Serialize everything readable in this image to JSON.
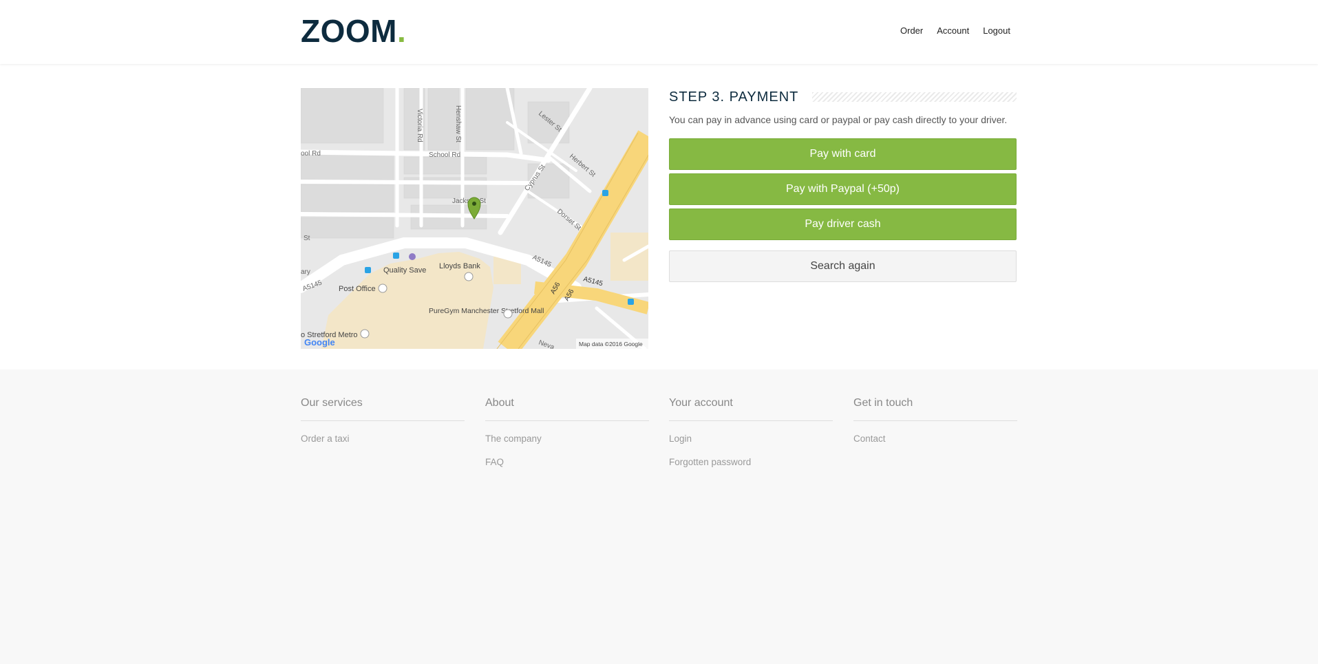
{
  "header": {
    "logo_text": "ZOOM",
    "logo_dot": ".",
    "nav": [
      "Order",
      "Account",
      "Logout"
    ]
  },
  "map": {
    "labels": {
      "victoria_rd": "Victoria Rd",
      "henshaw_st": "Henshaw St",
      "lester_st": "Lester St",
      "school_rd": "School Rd",
      "school_rd_left": "ool Rd",
      "herbert_st": "Herbert St",
      "cyprus_st": "Cyprus St",
      "jackson_st": "Jackson St",
      "dorset_st": "Dorset St",
      "a5145_1": "A5145",
      "a5145_2": "A5145",
      "a5145_3": "A5145",
      "a56_1": "A56",
      "a56_2": "A56",
      "st": "St",
      "ary": "ary",
      "quality_save": "Quality Save",
      "lloyds_bank": "Lloyds Bank",
      "post_office": "Post Office",
      "puregym": "PureGym Manchester Stretford Mall",
      "stretford_metro": "o Stretford Metro",
      "neva": "Neva",
      "google": "Google",
      "attribution": "Map data ©2016 Google"
    },
    "colors": {
      "major_road": "#f8d67a",
      "marker": "#7cab37",
      "retail": "#f3e6c8"
    }
  },
  "payment": {
    "title": "STEP 3. PAYMENT",
    "description": "You can pay in advance using card or paypal or pay cash directly to your driver.",
    "buttons": {
      "card": "Pay with card",
      "paypal": "Pay with Paypal (+50p)",
      "cash": "Pay driver cash",
      "search": "Search again"
    },
    "accent": "#86b943"
  },
  "footer": {
    "columns": [
      {
        "heading": "Our services",
        "links": [
          "Order a taxi"
        ]
      },
      {
        "heading": "About",
        "links": [
          "The company",
          "FAQ"
        ]
      },
      {
        "heading": "Your account",
        "links": [
          "Login",
          "Forgotten password"
        ]
      },
      {
        "heading": "Get in touch",
        "links": [
          "Contact"
        ]
      }
    ]
  }
}
